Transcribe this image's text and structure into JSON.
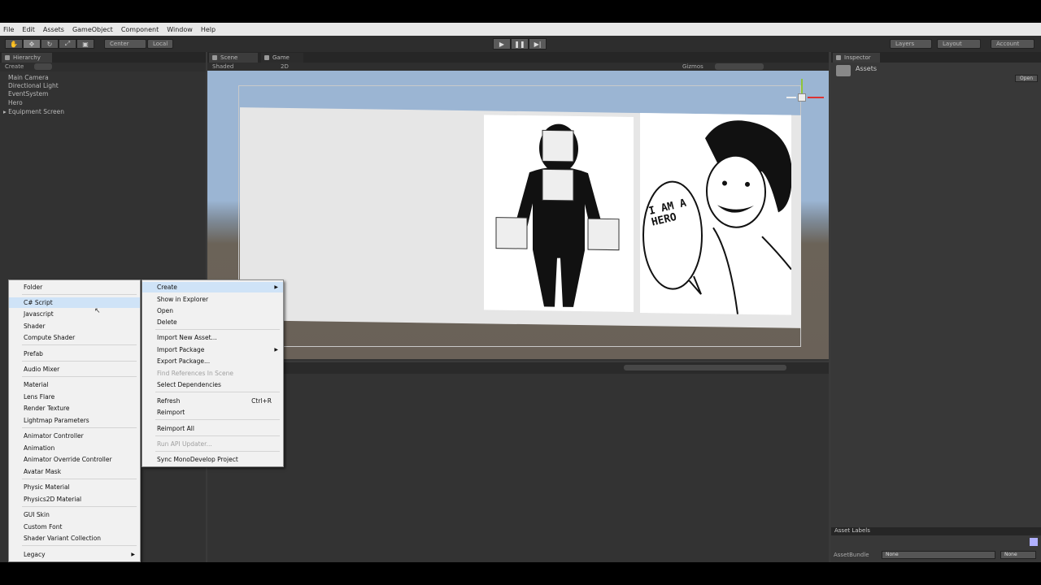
{
  "menubar": [
    "File",
    "Edit",
    "Assets",
    "GameObject",
    "Component",
    "Window",
    "Help"
  ],
  "toolbar": {
    "pivot_label": "Center",
    "space_label": "Local",
    "play_icon": "▶",
    "pause_icon": "❚❚",
    "step_icon": "▶|",
    "layers_label": "Layers",
    "layout_label": "Layout",
    "account_label": "Account"
  },
  "hierarchy": {
    "tab": "Hierarchy",
    "create": "Create",
    "items": [
      "Main Camera",
      "Directional Light",
      "EventSystem",
      "Hero",
      "Equipment Screen"
    ]
  },
  "scene": {
    "tab_scene": "Scene",
    "tab_game": "Game",
    "shading": "Shaded",
    "mode_2d": "2D",
    "gizmos": "Gizmos",
    "comic_text": "I AM A HERO"
  },
  "inspector": {
    "tab": "Inspector",
    "title": "Assets",
    "open_label": "Open",
    "asset_labels": "Asset Labels",
    "asset_bundle": "AssetBundle",
    "bundle_value": "None",
    "bundle_variant": "None"
  },
  "create_menu": {
    "items": [
      {
        "label": "Folder"
      },
      {
        "label": "C# Script",
        "highlighted": true
      },
      {
        "label": "Javascript"
      },
      {
        "label": "Shader"
      },
      {
        "label": "Compute Shader"
      },
      {
        "label": "Prefab"
      },
      {
        "label": "Audio Mixer"
      },
      {
        "label": "Material"
      },
      {
        "label": "Lens Flare"
      },
      {
        "label": "Render Texture"
      },
      {
        "label": "Lightmap Parameters"
      },
      {
        "label": "Animator Controller"
      },
      {
        "label": "Animation"
      },
      {
        "label": "Animator Override Controller"
      },
      {
        "label": "Avatar Mask"
      },
      {
        "label": "Physic Material"
      },
      {
        "label": "Physics2D Material"
      },
      {
        "label": "GUI Skin"
      },
      {
        "label": "Custom Font"
      },
      {
        "label": "Shader Variant Collection"
      },
      {
        "label": "Legacy"
      }
    ]
  },
  "assets_menu": {
    "items": [
      {
        "label": "Create"
      },
      {
        "label": "Show in Explorer"
      },
      {
        "label": "Open"
      },
      {
        "label": "Delete"
      },
      {
        "label": "Import New Asset..."
      },
      {
        "label": "Import Package"
      },
      {
        "label": "Export Package..."
      },
      {
        "label": "Find References In Scene",
        "disabled": true
      },
      {
        "label": "Select Dependencies"
      },
      {
        "label": "Refresh",
        "shortcut": "Ctrl+R"
      },
      {
        "label": "Reimport"
      },
      {
        "label": "Reimport All"
      },
      {
        "label": "Run API Updater...",
        "disabled": true
      },
      {
        "label": "Sync MonoDevelop Project"
      }
    ]
  }
}
